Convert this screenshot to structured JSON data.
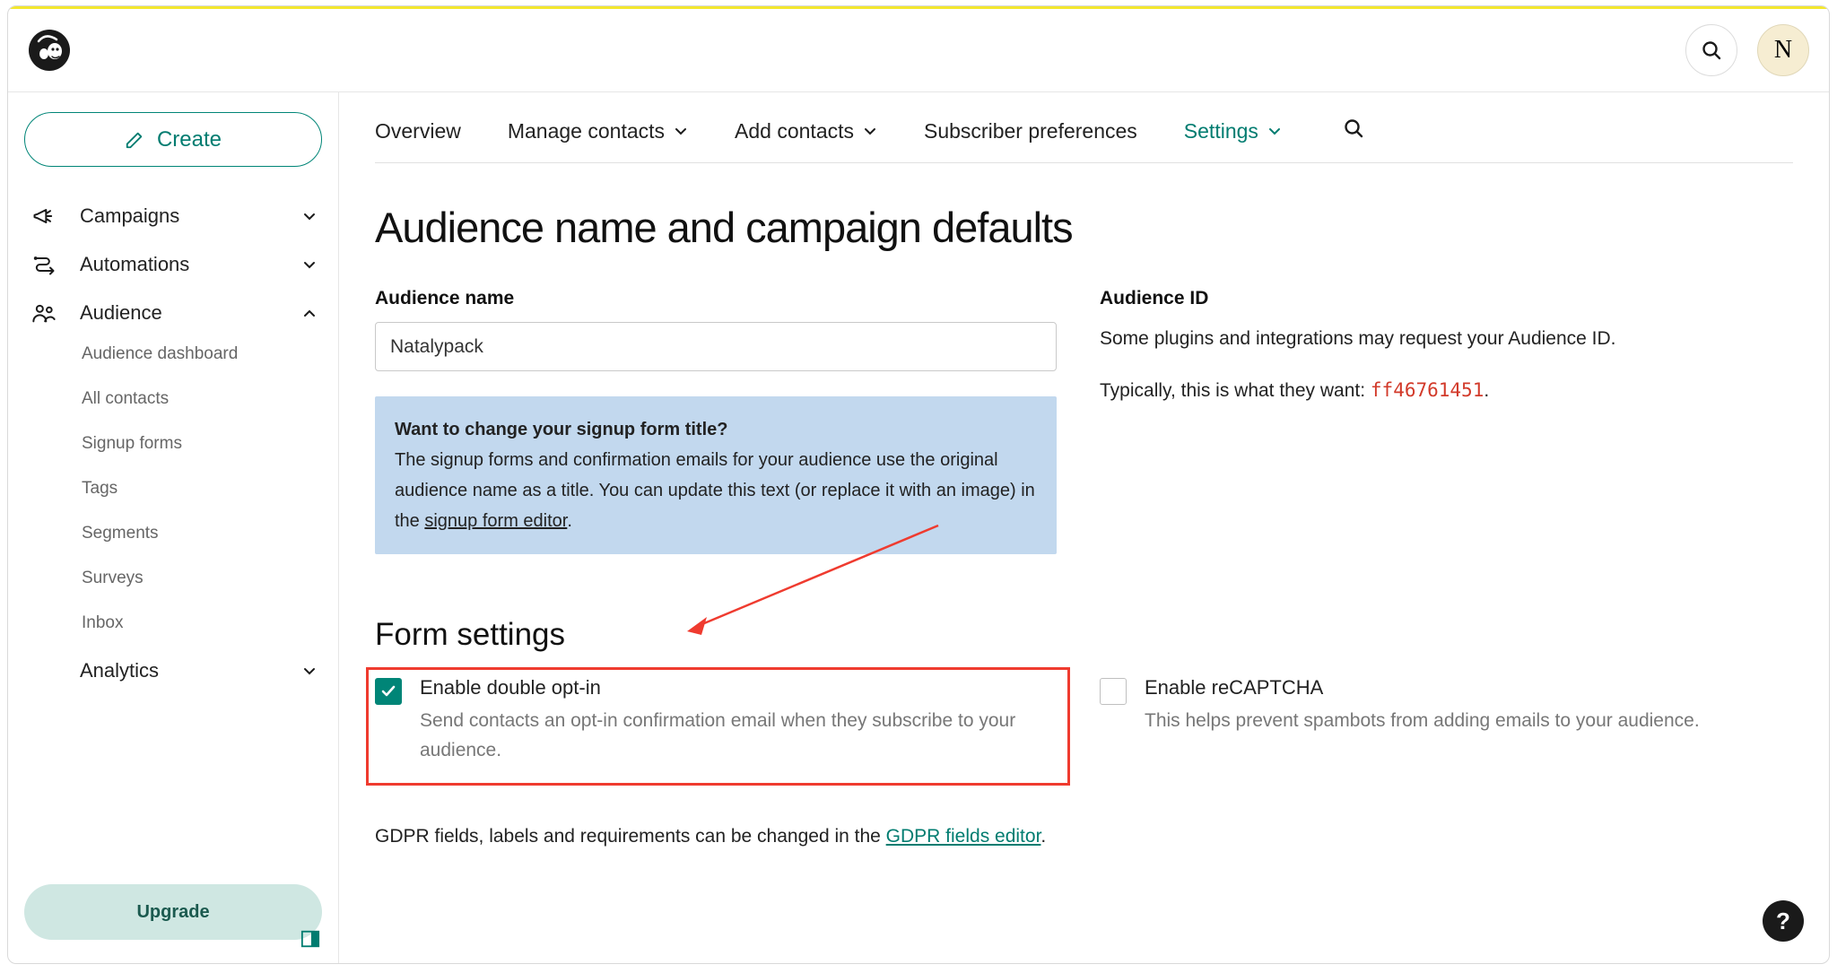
{
  "topbar": {
    "avatar_initial": "N"
  },
  "sidebar": {
    "create_label": "Create",
    "items": [
      {
        "label": "Campaigns",
        "expanded": false
      },
      {
        "label": "Automations",
        "expanded": false
      },
      {
        "label": "Audience",
        "expanded": true
      },
      {
        "label": "Analytics",
        "expanded": false
      }
    ],
    "audience_sub": [
      "Audience dashboard",
      "All contacts",
      "Signup forms",
      "Tags",
      "Segments",
      "Surveys",
      "Inbox"
    ],
    "upgrade_label": "Upgrade"
  },
  "tabs": {
    "items": [
      {
        "label": "Overview",
        "dropdown": false
      },
      {
        "label": "Manage contacts",
        "dropdown": true
      },
      {
        "label": "Add contacts",
        "dropdown": true
      },
      {
        "label": "Subscriber preferences",
        "dropdown": false
      },
      {
        "label": "Settings",
        "dropdown": true,
        "active": true
      }
    ]
  },
  "page": {
    "title": "Audience name and campaign defaults",
    "audience_name_label": "Audience name",
    "audience_name_value": "Natalypack",
    "info_question": "Want to change your signup form title?",
    "info_body_pre": "The signup forms and confirmation emails for your audience use the original audience name as a title. You can update this text (or replace it with an image) in the ",
    "info_link": "signup form editor",
    "audience_id_label": "Audience ID",
    "audience_id_line1": "Some plugins and integrations may request your Audience ID.",
    "audience_id_line2_pre": "Typically, this is what they want: ",
    "audience_id_code": "ff46761451",
    "form_settings_title": "Form settings",
    "double_optin": {
      "title": "Enable double opt-in",
      "desc": "Send contacts an opt-in confirmation email when they subscribe to your audience.",
      "checked": true
    },
    "recaptcha": {
      "title": "Enable reCAPTCHA",
      "desc": "This helps prevent spambots from adding emails to your audience.",
      "checked": false
    },
    "gdpr_pre": "GDPR fields, labels and requirements can be changed in the ",
    "gdpr_link": "GDPR fields editor"
  },
  "help_glyph": "?"
}
